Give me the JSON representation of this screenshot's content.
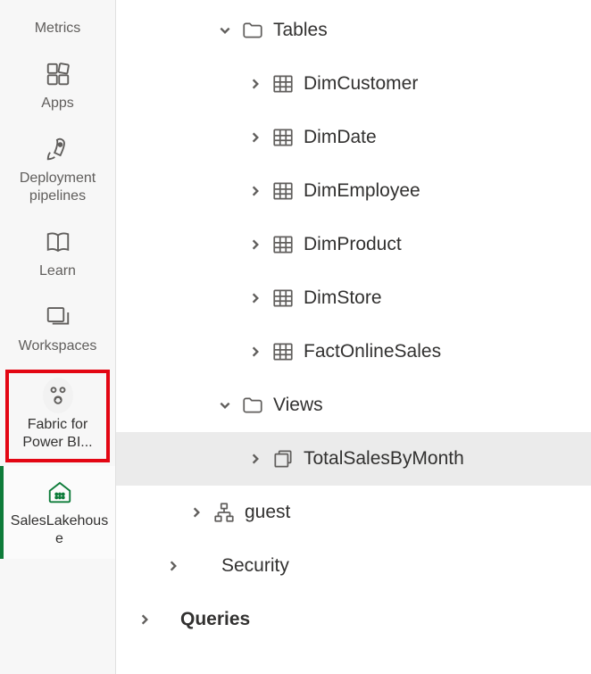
{
  "sidebar": {
    "items": [
      {
        "label": "Metrics",
        "icon": "metrics-icon"
      },
      {
        "label": "Apps",
        "icon": "apps-icon"
      },
      {
        "label": "Deployment pipelines",
        "icon": "rocket-icon"
      },
      {
        "label": "Learn",
        "icon": "book-icon"
      },
      {
        "label": "Workspaces",
        "icon": "workspaces-icon"
      },
      {
        "label": "Fabric for Power BI...",
        "icon": "fabric-icon"
      },
      {
        "label": "SalesLakehouse",
        "icon": "lakehouse-icon"
      }
    ]
  },
  "tree": {
    "tables": {
      "label": "Tables",
      "items": [
        "DimCustomer",
        "DimDate",
        "DimEmployee",
        "DimProduct",
        "DimStore",
        "FactOnlineSales"
      ]
    },
    "views": {
      "label": "Views",
      "items": [
        "TotalSalesByMonth"
      ]
    },
    "guest": {
      "label": "guest"
    },
    "security": {
      "label": "Security"
    },
    "queries": {
      "label": "Queries"
    }
  }
}
